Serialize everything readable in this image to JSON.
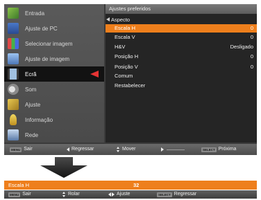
{
  "sidebar": {
    "items": [
      {
        "label": "Entrada",
        "icon": "input-icon",
        "color": "#5a9e3c"
      },
      {
        "label": "Ajuste de PC",
        "icon": "pc-adjust-icon",
        "color": "#3a63b0"
      },
      {
        "label": "Selecionar imagem",
        "icon": "image-select-icon",
        "color": "#c24a7a"
      },
      {
        "label": "Ajuste de imagem",
        "icon": "image-adjust-icon",
        "color": "#6b8ec9"
      },
      {
        "label": "Ecrã",
        "icon": "screen-icon",
        "color": "#7a7a7a",
        "selected": true
      },
      {
        "label": "Som",
        "icon": "speaker-icon",
        "color": "#b0b0b0"
      },
      {
        "label": "Ajuste",
        "icon": "settings-icon",
        "color": "#d9b23a"
      },
      {
        "label": "Informação",
        "icon": "info-icon",
        "color": "#e0c040"
      },
      {
        "label": "Rede",
        "icon": "network-icon",
        "color": "#8fb0d8"
      }
    ]
  },
  "panel": {
    "header": "Ajustes preferidos",
    "submenu": "Aspecto",
    "options": [
      {
        "name": "Escala H",
        "value": "0",
        "highlight": true
      },
      {
        "name": "Escala V",
        "value": "0"
      },
      {
        "name": "H&V",
        "value": "Desligado"
      },
      {
        "name": "Posição H",
        "value": "0"
      },
      {
        "name": "Posição V",
        "value": "0"
      },
      {
        "name": "Comum",
        "value": ""
      },
      {
        "name": "Restabelecer",
        "value": ""
      }
    ]
  },
  "footer": {
    "exit_key": "MENU",
    "exit": "Sair",
    "back": "Regressar",
    "move": "Mover",
    "next_key": "SELECT",
    "next": "Próxima"
  },
  "bottom": {
    "name": "Escala H",
    "value": "32",
    "exit_key": "MENU",
    "exit": "Sair",
    "scroll": "Rolar",
    "adjust": "Ajuste",
    "back_key": "SELECT",
    "back": "Regressar"
  },
  "colors": {
    "highlight": "#ee7f1c",
    "pointer": "#e53434"
  }
}
